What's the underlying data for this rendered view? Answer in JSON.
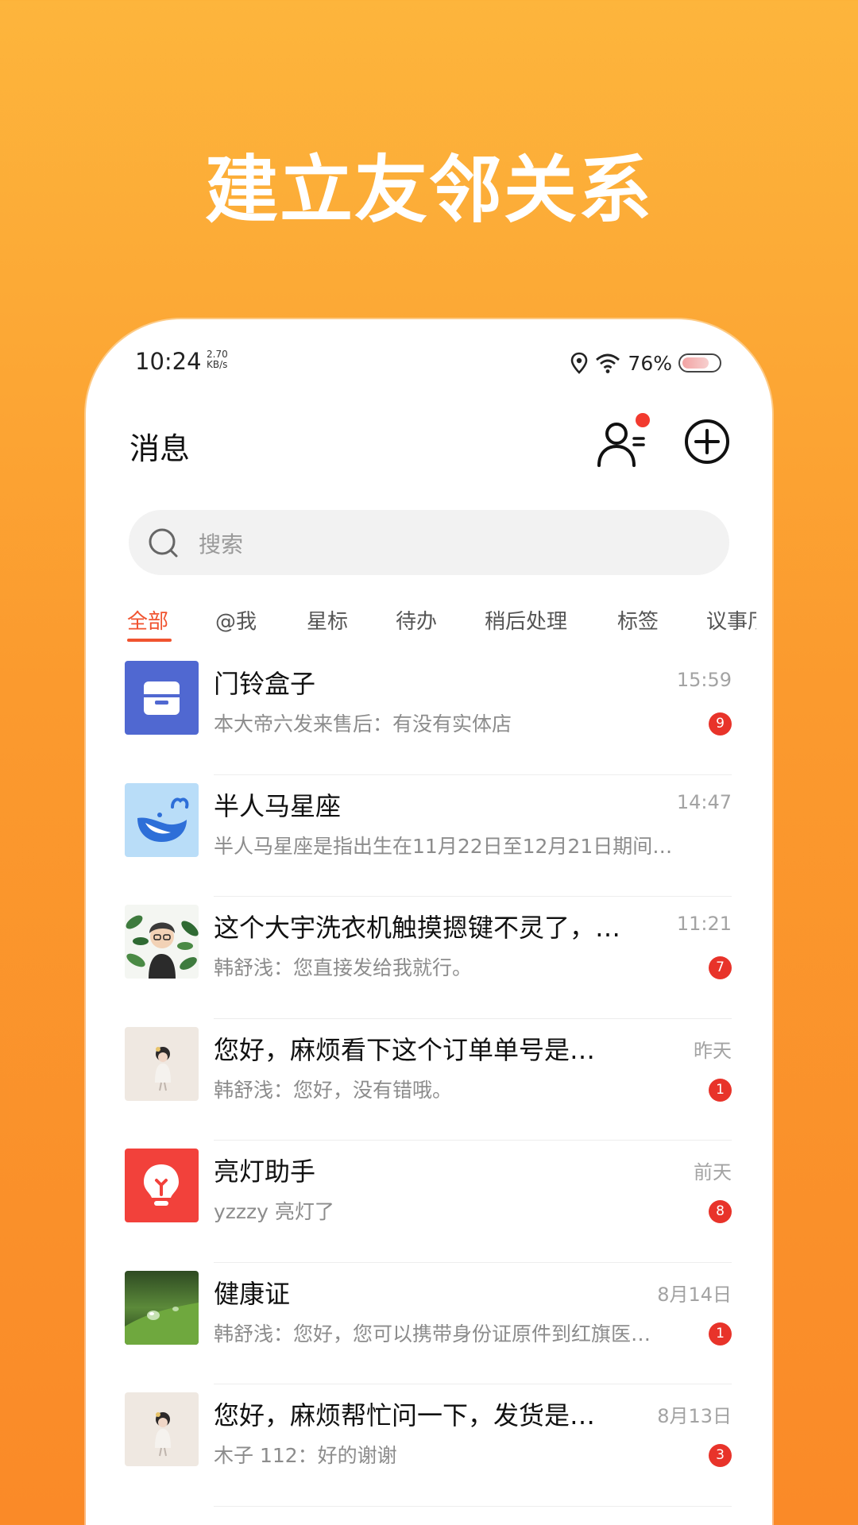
{
  "headline": "建立友邻关系",
  "status_bar": {
    "time": "10:24",
    "speed_value": "2.70",
    "speed_unit": "KB/s",
    "battery_percent": "76%"
  },
  "header": {
    "title": "消息"
  },
  "search": {
    "placeholder": "搜索"
  },
  "tabs": [
    {
      "label": "全部",
      "active": true
    },
    {
      "label": "@我"
    },
    {
      "label": "星标"
    },
    {
      "label": "待办"
    },
    {
      "label": "稍后处理"
    },
    {
      "label": "标签"
    },
    {
      "label": "议事厅"
    }
  ],
  "messages": [
    {
      "title": "门铃盒子",
      "preview": "本大帝六发来售后：有没有实体店",
      "time": "15:59",
      "badge": "9",
      "avatar": "box-icon"
    },
    {
      "title": "半人马星座",
      "preview": "半人马星座是指出生在11月22日至12月21日期间…",
      "time": "14:47",
      "badge": "",
      "avatar": "whale-icon"
    },
    {
      "title": "这个大宇洗衣机触摸摁键不灵了，…",
      "preview": "韩舒浅：您直接发给我就行。",
      "time": "11:21",
      "badge": "7",
      "avatar": "person-photo"
    },
    {
      "title": "您好，麻烦看下这个订单单号是…",
      "preview": "韩舒浅：您好，没有错哦。",
      "time": "昨天",
      "badge": "1",
      "avatar": "girl-photo"
    },
    {
      "title": "亮灯助手",
      "preview": "yzzzy 亮灯了",
      "time": "前天",
      "badge": "8",
      "avatar": "bulb-icon"
    },
    {
      "title": "健康证",
      "preview": "韩舒浅：您好，您可以携带身份证原件到红旗医…",
      "time": "8月14日",
      "badge": "1",
      "avatar": "leaf-photo"
    },
    {
      "title": "您好，麻烦帮忙问一下，发货是…",
      "preview": "木子 112：好的谢谢",
      "time": "8月13日",
      "badge": "3",
      "avatar": "girl-photo"
    }
  ],
  "colors": {
    "accent": "#F0532F",
    "badge": "#E8332A",
    "background_top": "#FDB53C",
    "background_bottom": "#FA8A28"
  }
}
